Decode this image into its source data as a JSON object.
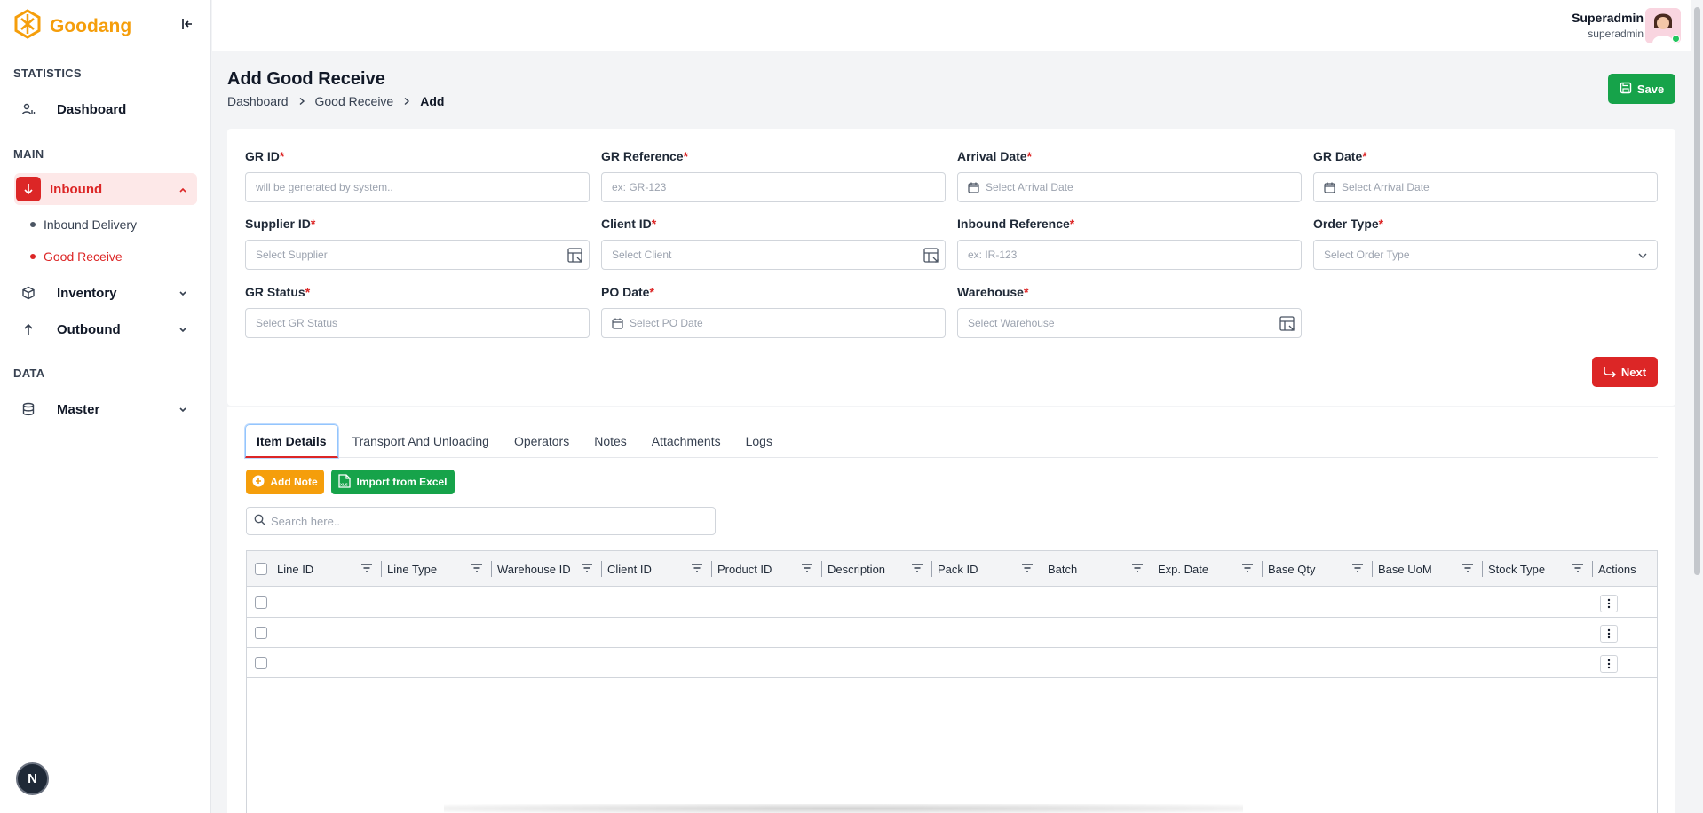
{
  "brand": {
    "name": "Goodang"
  },
  "sidebar": {
    "sections": {
      "statistics": "STATISTICS",
      "main": "MAIN",
      "data": "DATA"
    },
    "dashboard": "Dashboard",
    "inbound": "Inbound",
    "inbound_children": [
      "Inbound Delivery",
      "Good Receive"
    ],
    "inventory": "Inventory",
    "outbound": "Outbound",
    "master": "Master",
    "badge": "N"
  },
  "user": {
    "name": "Superadmin",
    "role": "superadmin"
  },
  "page": {
    "title": "Add Good Receive",
    "breadcrumb": [
      "Dashboard",
      "Good Receive",
      "Add"
    ],
    "save_label": "Save",
    "next_label": "Next"
  },
  "form": {
    "gr_id": {
      "label": "GR ID",
      "placeholder": "will be generated by system.."
    },
    "gr_reference": {
      "label": "GR Reference",
      "placeholder": "ex: GR-123"
    },
    "arrival_date": {
      "label": "Arrival Date",
      "placeholder": "Select Arrival Date"
    },
    "gr_date": {
      "label": "GR Date",
      "placeholder": "Select Arrival Date"
    },
    "supplier_id": {
      "label": "Supplier ID",
      "placeholder": "Select Supplier"
    },
    "client_id": {
      "label": "Client ID",
      "placeholder": "Select Client"
    },
    "inbound_reference": {
      "label": "Inbound Reference",
      "placeholder": "ex: IR-123"
    },
    "order_type": {
      "label": "Order Type",
      "placeholder": "Select Order Type"
    },
    "gr_status": {
      "label": "GR Status",
      "placeholder": "Select GR Status"
    },
    "po_date": {
      "label": "PO Date",
      "placeholder": "Select PO Date"
    },
    "warehouse": {
      "label": "Warehouse",
      "placeholder": "Select Warehouse"
    }
  },
  "tabs": [
    "Item Details",
    "Transport And Unloading",
    "Operators",
    "Notes",
    "Attachments",
    "Logs"
  ],
  "actions": {
    "add_note": "Add Note",
    "import_excel": "Import from Excel",
    "excel_icon_text": "XLS"
  },
  "search": {
    "placeholder": "Search here.."
  },
  "table": {
    "columns": [
      "Line ID",
      "Line Type",
      "Warehouse ID",
      "Client ID",
      "Product ID",
      "Description",
      "Pack ID",
      "Batch",
      "Exp. Date",
      "Base Qty",
      "Base UoM",
      "Stock Type",
      "Actions"
    ],
    "row_count": 3
  },
  "colors": {
    "accent": "#dc2626",
    "brand": "#f59e0b",
    "success": "#16a34a"
  }
}
